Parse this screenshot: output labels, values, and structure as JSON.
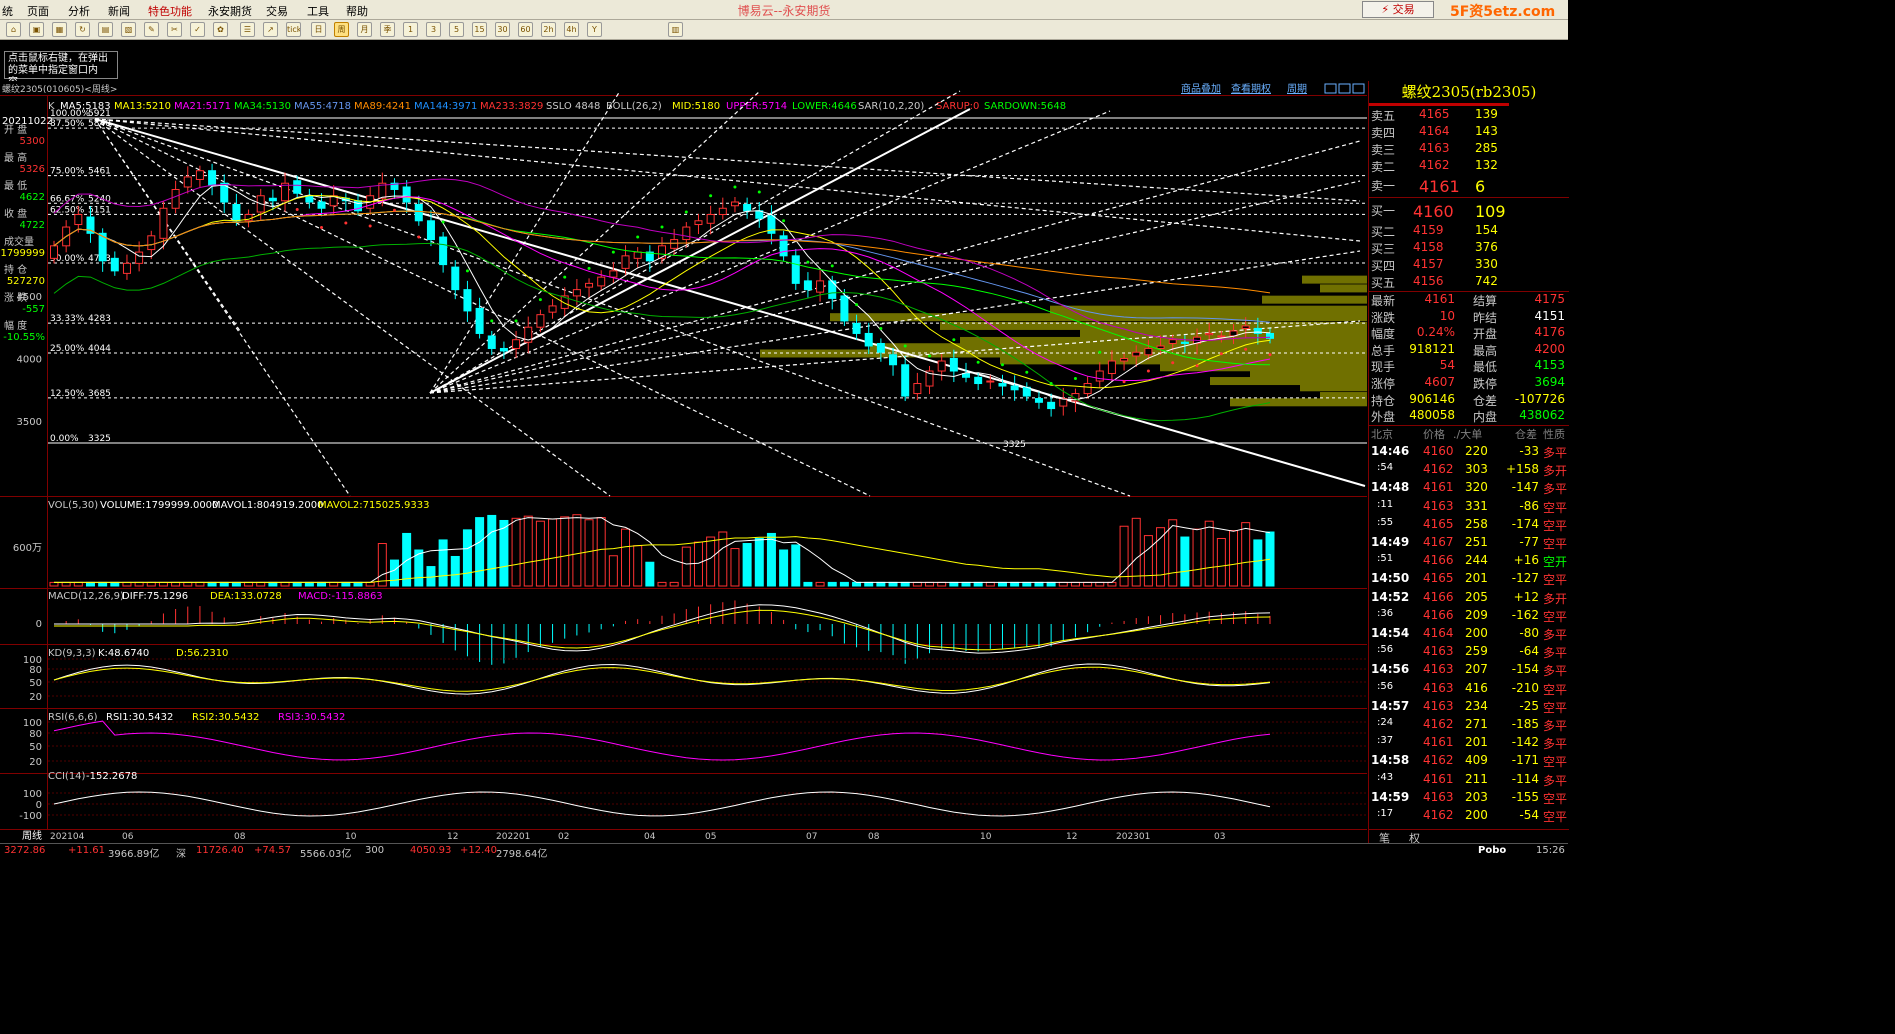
{
  "menu": {
    "items": [
      "统",
      "页面",
      "分析",
      "新闻",
      "特色功能",
      "永安期货",
      "交易",
      "工具",
      "帮助"
    ],
    "app_title": "博易云--永安期货",
    "trade_button": "⚡ 交易",
    "watermark": "5F资5etz.com"
  },
  "toolbar": {
    "buttons": [
      "⌂",
      "▣",
      "▦",
      "↻",
      "▤",
      "▧",
      "✎",
      "✂",
      "✓",
      "✿",
      "☰",
      "↗",
      "tick",
      "日",
      "周",
      "月",
      "季",
      "1",
      "3",
      "5",
      "15",
      "30",
      "60",
      "2h",
      "4h",
      "Y",
      "▥"
    ]
  },
  "hint": {
    "text": "点击鼠标右键，在弹出的菜单中指定窗口内容。"
  },
  "chart": {
    "header_left": "螺纹2305(010605)<周线>",
    "header_links": [
      "商品叠加",
      "查看期权",
      "周期"
    ],
    "ma_line": [
      {
        "text": "K",
        "color": "#c8c8c8"
      },
      {
        "text": "MA5:5183",
        "color": "#ffffff"
      },
      {
        "text": "MA13:5210",
        "color": "#ffff00"
      },
      {
        "text": "MA21:5171",
        "color": "#ff00ff"
      },
      {
        "text": "MA34:5130",
        "color": "#00ff00"
      },
      {
        "text": "MA55:4718",
        "color": "#6495ed"
      },
      {
        "text": "MA89:4241",
        "color": "#ff8c00"
      },
      {
        "text": "MA144:3971",
        "color": "#1e90ff"
      },
      {
        "text": "MA233:3829",
        "color": "#ff3232"
      },
      {
        "text": "SSLO 4848",
        "color": "#c8c8c8"
      },
      {
        "text": "BOLL(26,2)",
        "color": "#c8c8c8"
      },
      {
        "text": "MID:5180",
        "color": "#ffff00"
      },
      {
        "text": "UPPER:5714",
        "color": "#ff00ff"
      },
      {
        "text": "LOWER:4646",
        "color": "#00ff00"
      },
      {
        "text": "SAR(10,2,20)",
        "color": "#c8c8c8"
      },
      {
        "text": "SARUP:0",
        "color": "#ff3232"
      },
      {
        "text": "SARDOWN:5648",
        "color": "#00ff00"
      }
    ],
    "left_info": {
      "date": "20211022",
      "rows": [
        {
          "label": "开 盘",
          "value": "5300"
        },
        {
          "label": "最 高",
          "value": "5326"
        },
        {
          "label": "最 低",
          "value": "4622"
        },
        {
          "label": "收 盘",
          "value": "4722"
        },
        {
          "label": "成交量",
          "value": "1799999"
        },
        {
          "label": "持 仓",
          "value": "527270"
        },
        {
          "label": "涨 跌",
          "value": "-557"
        },
        {
          "label": "幅 度",
          "value": "-10.55%"
        }
      ]
    },
    "y_ticks": [
      "4500",
      "4000",
      "3500"
    ],
    "fib_levels": [
      {
        "label": "100.00%",
        "value": "5921"
      },
      {
        "label": "87.50%",
        "value": "5840"
      },
      {
        "label": "75.00%",
        "value": "5461"
      },
      {
        "label": "66.67%",
        "value": "5240"
      },
      {
        "label": "62.50%",
        "value": "5151"
      },
      {
        "label": "50.00%",
        "value": "4763"
      },
      {
        "label": "33.33%",
        "value": "4283"
      },
      {
        "label": "25.00%",
        "value": "4044"
      },
      {
        "label": "12.50%",
        "value": "3685"
      },
      {
        "label": "0.00%",
        "value": "3325"
      }
    ],
    "low_label": "3325",
    "vol": {
      "title": "VOL(5,30)",
      "volume": "VOLUME:1799999.0000",
      "mavol1": "MAVOL1:804919.2000",
      "mavol2": "MAVOL2:715025.9333",
      "y_label": "600万"
    },
    "macd": {
      "title": "MACD(12,26,9)",
      "diff": "DIFF:75.1296",
      "dea": "DEA:133.0728",
      "macd": "MACD:-115.8863",
      "y_label": "0"
    },
    "kd": {
      "title": "KD(9,3,3)",
      "k": "K:48.6740",
      "d": "D:56.2310",
      "y_labels": [
        "100",
        "80",
        "50",
        "20"
      ]
    },
    "rsi": {
      "title": "RSI(6,6,6)",
      "rsi1": "RSI1:30.5432",
      "rsi2": "RSI2:30.5432",
      "rsi3": "RSI3:30.5432",
      "y_labels": [
        "100",
        "80",
        "50",
        "20"
      ]
    },
    "cci": {
      "title": "CCI(14)",
      "value": "-152.2678",
      "y_labels": [
        "100",
        "0",
        "-100"
      ]
    },
    "x_axis": {
      "period_label": "周线",
      "labels": [
        "202104",
        "06",
        "08",
        "10",
        "12",
        "202201",
        "02",
        "04",
        "05",
        "07",
        "08",
        "10",
        "12",
        "202301",
        "03"
      ]
    }
  },
  "quote": {
    "title": "螺纹2305(rb2305)",
    "asks": [
      {
        "label": "卖五",
        "price": "4165",
        "vol": "139"
      },
      {
        "label": "卖四",
        "price": "4164",
        "vol": "143"
      },
      {
        "label": "卖三",
        "price": "4163",
        "vol": "285"
      },
      {
        "label": "卖二",
        "price": "4162",
        "vol": "132"
      },
      {
        "label": "卖一",
        "price": "4161",
        "vol": "6"
      }
    ],
    "bids": [
      {
        "label": "买一",
        "price": "4160",
        "vol": "109"
      },
      {
        "label": "买二",
        "price": "4159",
        "vol": "154"
      },
      {
        "label": "买三",
        "price": "4158",
        "vol": "376"
      },
      {
        "label": "买四",
        "price": "4157",
        "vol": "330"
      },
      {
        "label": "买五",
        "price": "4156",
        "vol": "742"
      }
    ],
    "stats": [
      {
        "l1": "最新",
        "v1": "4161",
        "l2": "结算",
        "v2": "4175"
      },
      {
        "l1": "涨跌",
        "v1": "10",
        "l2": "昨结",
        "v2": "4151"
      },
      {
        "l1": "幅度",
        "v1": "0.24%",
        "l2": "开盘",
        "v2": "4176"
      },
      {
        "l1": "总手",
        "v1": "918121",
        "l2": "最高",
        "v2": "4200"
      },
      {
        "l1": "现手",
        "v1": "54",
        "l2": "最低",
        "v2": "4153"
      },
      {
        "l1": "涨停",
        "v1": "4607",
        "l2": "跌停",
        "v2": "3694"
      },
      {
        "l1": "持仓",
        "v1": "906146",
        "l2": "仓差",
        "v2": "-107726"
      },
      {
        "l1": "外盘",
        "v1": "480058",
        "l2": "内盘",
        "v2": "438062"
      }
    ],
    "ticks_header": [
      "北京",
      "价格",
      "./大单",
      "仓差",
      "性质"
    ],
    "ticks": [
      {
        "time": "14:46",
        "price": "4160",
        "vol": "220",
        "diff": "-33",
        "nature": "多平"
      },
      {
        "time": ":54",
        "price": "4162",
        "vol": "303",
        "diff": "+158",
        "nature": "多开"
      },
      {
        "time": "14:48",
        "price": "4161",
        "vol": "320",
        "diff": "-147",
        "nature": "多平"
      },
      {
        "time": ":11",
        "price": "4163",
        "vol": "331",
        "diff": "-86",
        "nature": "空平"
      },
      {
        "time": ":55",
        "price": "4165",
        "vol": "258",
        "diff": "-174",
        "nature": "空平"
      },
      {
        "time": "14:49",
        "price": "4167",
        "vol": "251",
        "diff": "-77",
        "nature": "空平"
      },
      {
        "time": ":51",
        "price": "4166",
        "vol": "244",
        "diff": "+16",
        "nature": "空开"
      },
      {
        "time": "14:50",
        "price": "4165",
        "vol": "201",
        "diff": "-127",
        "nature": "空平"
      },
      {
        "time": "14:52",
        "price": "4166",
        "vol": "205",
        "diff": "+12",
        "nature": "多开"
      },
      {
        "time": ":36",
        "price": "4166",
        "vol": "209",
        "diff": "-162",
        "nature": "空平"
      },
      {
        "time": "14:54",
        "price": "4164",
        "vol": "200",
        "diff": "-80",
        "nature": "多平"
      },
      {
        "time": ":56",
        "price": "4163",
        "vol": "259",
        "diff": "-64",
        "nature": "多平"
      },
      {
        "time": "14:56",
        "price": "4163",
        "vol": "207",
        "diff": "-154",
        "nature": "多平"
      },
      {
        "time": ":56",
        "price": "4163",
        "vol": "416",
        "diff": "-210",
        "nature": "空平"
      },
      {
        "time": "14:57",
        "price": "4163",
        "vol": "234",
        "diff": "-25",
        "nature": "空平"
      },
      {
        "time": ":24",
        "price": "4162",
        "vol": "271",
        "diff": "-185",
        "nature": "多平"
      },
      {
        "time": ":37",
        "price": "4161",
        "vol": "201",
        "diff": "-142",
        "nature": "多平"
      },
      {
        "time": "14:58",
        "price": "4162",
        "vol": "409",
        "diff": "-171",
        "nature": "空平"
      },
      {
        "time": ":43",
        "price": "4161",
        "vol": "211",
        "diff": "-114",
        "nature": "多平"
      },
      {
        "time": "14:59",
        "price": "4163",
        "vol": "203",
        "diff": "-155",
        "nature": "空平"
      },
      {
        "time": ":17",
        "price": "4162",
        "vol": "200",
        "diff": "-54",
        "nature": "空平"
      }
    ],
    "tabs": [
      "笔",
      "权"
    ]
  },
  "status": {
    "items": [
      {
        "text": "3272.86",
        "color": "#ff3232"
      },
      {
        "text": "+11.61",
        "color": "#ff3232"
      },
      {
        "text": "3966.89亿",
        "color": "#c8c8c8"
      },
      {
        "text": "深",
        "color": "#c8c8c8"
      },
      {
        "text": "11726.40",
        "color": "#ff3232"
      },
      {
        "text": "+74.57",
        "color": "#ff3232"
      },
      {
        "text": "5566.03亿",
        "color": "#c8c8c8"
      },
      {
        "text": "300",
        "color": "#c8c8c8"
      },
      {
        "text": "4050.93",
        "color": "#ff3232"
      },
      {
        "text": "+12.40",
        "color": "#ff3232"
      },
      {
        "text": "2798.64亿",
        "color": "#c8c8c8"
      }
    ],
    "brand": "Pobo",
    "time": "15:26"
  },
  "colors": {
    "up": "#ff3232",
    "down": "#00ffff",
    "bg": "#000000",
    "grid": "#800000",
    "fibbar": "#707000"
  }
}
